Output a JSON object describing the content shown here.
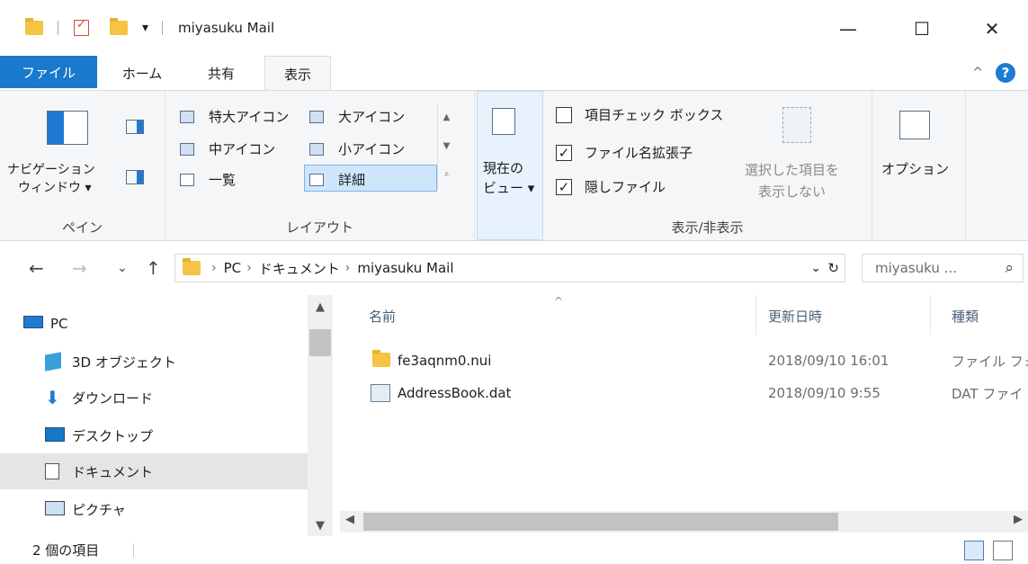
{
  "window": {
    "title": "miyasuku Mail",
    "minimize": "—",
    "maximize": "☐",
    "close": "✕",
    "qat_dropdown": "▾"
  },
  "ribbon_tabs": {
    "file": "ファイル",
    "home": "ホーム",
    "share": "共有",
    "view": "表示",
    "collapse_chevron": "^",
    "help": "?"
  },
  "ribbon": {
    "pane_group": {
      "label": "ペイン",
      "nav_pane_line1": "ナビゲーション",
      "nav_pane_line2": "ウィンドウ ▾"
    },
    "layout_group": {
      "label": "レイアウト",
      "extra_large": "特大アイコン",
      "large": "大アイコン",
      "medium": "中アイコン",
      "small": "小アイコン",
      "list": "一覧",
      "details": "詳細"
    },
    "current_view": {
      "line1": "現在の",
      "line2": "ビュー ▾"
    },
    "show_hide_group": {
      "label": "表示/非表示",
      "item_checkboxes": "項目チェック ボックス",
      "file_extensions": "ファイル名拡張子",
      "hidden_items": "隠しファイル",
      "item_checkboxes_checked": false,
      "file_extensions_checked": true,
      "hidden_items_checked": true,
      "hide_selected_line1": "選択した項目を",
      "hide_selected_line2": "表示しない"
    },
    "options": "オプション"
  },
  "address": {
    "segments": [
      "PC",
      "ドキュメント",
      "miyasuku Mail"
    ],
    "separator": "›",
    "dropdown": "⌄",
    "refresh": "↻",
    "search_placeholder": "miyasuku ... ",
    "search_icon": "⌕"
  },
  "nav_buttons": {
    "back": "←",
    "forward": "→",
    "recent": "⌄",
    "up": "↑"
  },
  "nav_pane": [
    {
      "label": "PC",
      "icon": "pc-icon"
    },
    {
      "label": "3D オブジェクト",
      "icon": "3d-objects-icon"
    },
    {
      "label": "ダウンロード",
      "icon": "download-icon"
    },
    {
      "label": "デスクトップ",
      "icon": "desktop-icon"
    },
    {
      "label": "ドキュメント",
      "icon": "documents-icon"
    },
    {
      "label": "ピクチャ",
      "icon": "pictures-icon"
    }
  ],
  "columns": {
    "name": "名前",
    "modified": "更新日時",
    "type": "種類",
    "sort_indicator": "^"
  },
  "files": [
    {
      "name": "fe3aqnm0.nui",
      "modified": "2018/09/10 16:01",
      "type": "ファイル フォ",
      "icon": "folder-icon"
    },
    {
      "name": "AddressBook.dat",
      "modified": "2018/09/10 9:55",
      "type": "DAT ファイ",
      "icon": "file-icon"
    }
  ],
  "status": {
    "count": "2 個の項目"
  },
  "colors": {
    "file_tab": "#1979ca",
    "ribbon_bg": "#f5f6f7",
    "selection": "#cde6fb",
    "folder": "#f6c344"
  }
}
